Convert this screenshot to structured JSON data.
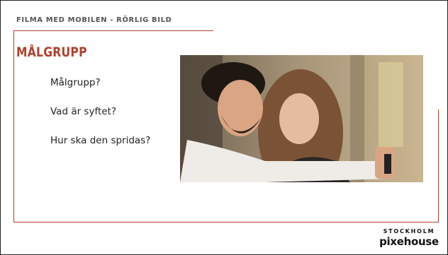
{
  "slide": {
    "header": "FILMA MED MOBILEN - RÖRLIG BILD",
    "title": "MÅLGRUPP",
    "bullets": [
      "Målgrupp?",
      "Vad är syftet?",
      "Hur ska den spridas?"
    ]
  },
  "photo": {
    "icon": "photo-couple-with-phone"
  },
  "logo": {
    "city": "STOCKHOLM",
    "brand": "pixehouse"
  },
  "colors": {
    "accent": "#b0402b",
    "text": "#222222"
  }
}
